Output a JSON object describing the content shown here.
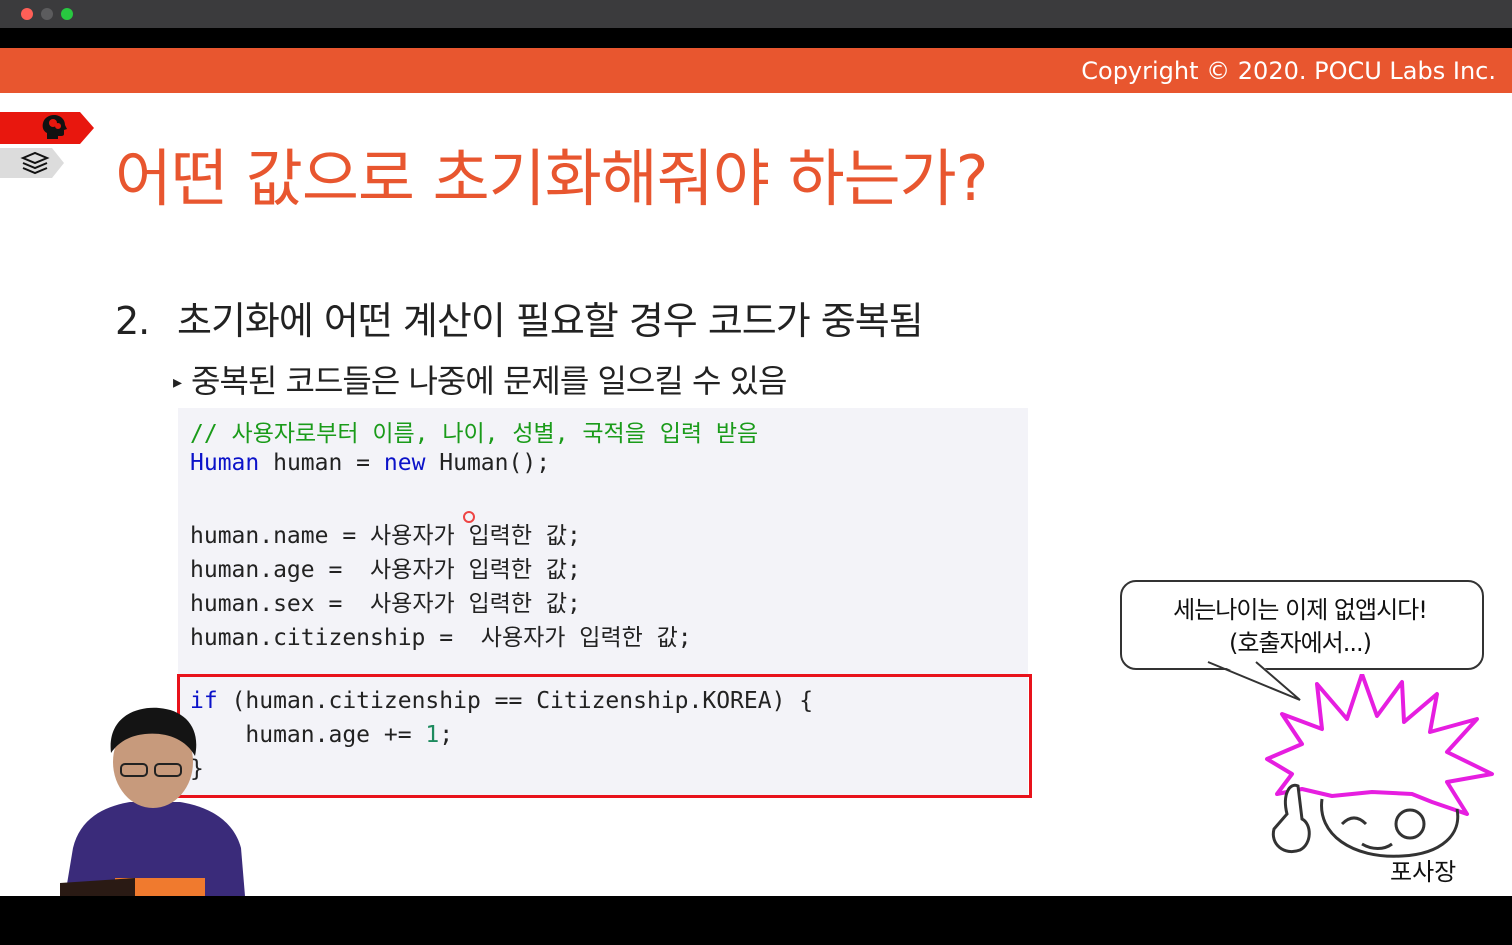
{
  "window": {
    "traffic_lights": [
      "close",
      "minimize",
      "maximize"
    ]
  },
  "banner": {
    "copyright": "Copyright © 2020. POCU Labs Inc."
  },
  "slide": {
    "title": "어떤 값으로 초기화해줘야 하는가?",
    "point_number": "2.",
    "point_text": "초기화에 어떤 계산이 필요할 경우 코드가 중복됨",
    "sub_bullet": "▸",
    "sub_text": "중복된 코드들은 나중에 문제를 일으킬 수 있음"
  },
  "code": {
    "comment": "// 사용자로부터 이름, 나이, 성별, 국적을 입력 받음",
    "line2_type": "Human",
    "line2_rest": " human = ",
    "line2_new": "new",
    "line2_end": " Human();",
    "line4": "human.name = 사용자가 입력한 값;",
    "line5": "human.age =  사용자가 입력한 값;",
    "line6": "human.sex =  사용자가 입력한 값;",
    "line7": "human.citizenship =  사용자가 입력한 값;",
    "if_kw": "if",
    "if_rest": " (human.citizenship == Citizenship.KOREA) {",
    "inc_start": "    human.age += ",
    "inc_num": "1",
    "inc_end": ";",
    "close": "}"
  },
  "callout": {
    "line1": "세는나이는 이제 없앱시다!",
    "line2": "(호출자에서...)",
    "character_name": "포사장"
  },
  "colors": {
    "accent": "#e8562f",
    "keyword": "#0b12c9",
    "comment": "#1a9b1a",
    "highlight_box": "#e8121b"
  },
  "icons": [
    "brain-head-icon",
    "book-stack-icon"
  ]
}
